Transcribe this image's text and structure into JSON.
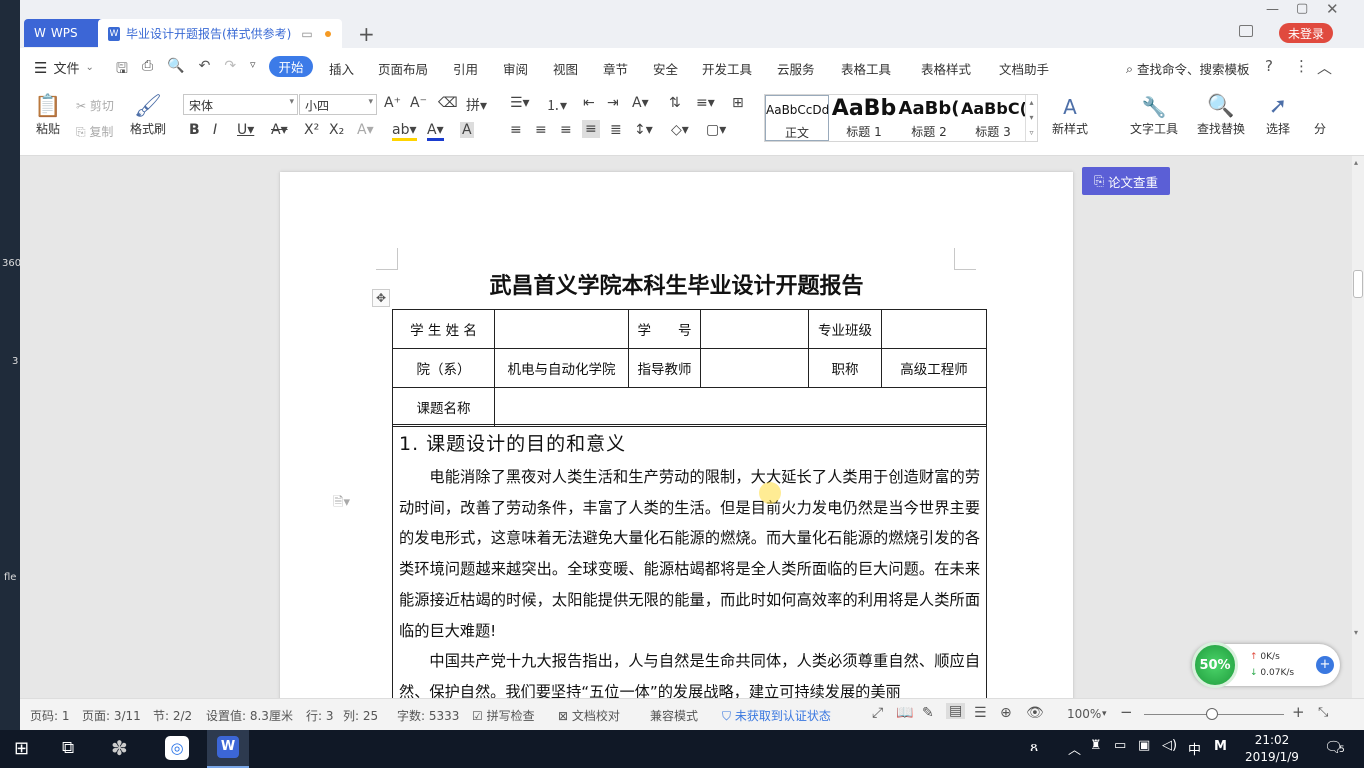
{
  "desktop": {
    "labels": [
      "360",
      "3",
      "fle"
    ]
  },
  "titlebar": {
    "wps_tab": "WPS",
    "doc_tab": "毕业设计开题报告(样式供参考)",
    "login": "未登录"
  },
  "menubar": {
    "file": "文件",
    "items": [
      "开始",
      "插入",
      "页面布局",
      "引用",
      "审阅",
      "视图",
      "章节",
      "安全",
      "开发工具",
      "云服务",
      "表格工具",
      "表格样式",
      "文档助手"
    ],
    "search": "查找命令、搜索模板"
  },
  "ribbon": {
    "paste": "粘贴",
    "cut": "剪切",
    "copy": "复制",
    "format_painter": "格式刷",
    "font_name": "宋体",
    "font_size": "小四",
    "styles": [
      {
        "preview": "AaBbCcDd",
        "label": "正文"
      },
      {
        "preview": "AaBb",
        "label": "标题 1"
      },
      {
        "preview": "AaBb(",
        "label": "标题 2"
      },
      {
        "preview": "AaBbC(",
        "label": "标题 3"
      }
    ],
    "new_style": "新样式",
    "text_tools": "文字工具",
    "find_replace": "查找替换",
    "select": "选择",
    "split": "分"
  },
  "document": {
    "title": "武昌首义学院本科生毕业设计开题报告",
    "table": {
      "r1": [
        "学 生 姓 名",
        "",
        "学　　号",
        "",
        "专业班级",
        ""
      ],
      "r2": [
        "院（系）",
        "机电与自动化学院",
        "指导教师",
        "",
        "职称",
        "高级工程师"
      ],
      "r3": [
        "课题名称",
        ""
      ]
    },
    "section_heading": "1.   课题设计的目的和意义",
    "paragraphs": [
      "电能消除了黑夜对人类生活和生产劳动的限制，大大延长了人类用于创造财富的劳动时间，改善了劳动条件，丰富了人类的生活。但是目前火力发电仍然是当今世界主要的发电形式，这意味着无法避免大量化石能源的燃烧。而大量化石能源的燃烧引发的各类环境问题越来越突出。全球变暖、能源枯竭都将是全人类所面临的巨大问题。在未来能源接近枯竭的时候，太阳能提供无限的能量，而此时如何高效率的利用将是人类所面临的巨大难题!",
      "中国共产党十九大报告指出，人与自然是生命共同体，人类必须尊重自然、顺应自然、保护自然。我们要坚持“五位一体”的发展战略，建立可持续发展的美丽"
    ]
  },
  "side": {
    "paper_check": "论文查重"
  },
  "net": {
    "percent": "50%",
    "up": "0K/s",
    "down": "0.07K/s"
  },
  "status": {
    "page_code": "页码: 1",
    "page": "页面: 3/11",
    "section": "节: 2/2",
    "setting": "设置值: 8.3厘米",
    "row": "行: 3",
    "col": "列: 25",
    "words": "字数: 5333",
    "spell": "拼写检查",
    "proof": "文档校对",
    "compat": "兼容模式",
    "auth": "未获取到认证状态",
    "zoom": "100%"
  },
  "taskbar": {
    "ime": "中",
    "ime2": "M",
    "time": "21:02",
    "date": "2019/1/9",
    "notif": "5"
  },
  "colors": {
    "accent": "#3c7be8",
    "wps_blue": "#3c66d6",
    "login_red": "#e04a3e",
    "paper_purple": "#5b5fd6"
  }
}
